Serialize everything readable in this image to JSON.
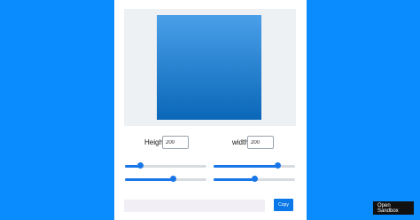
{
  "controls": {
    "height_label": "Height",
    "height_value": "200",
    "width_label": "width",
    "width_value": "200"
  },
  "sliders": [
    {
      "name": "slider-1",
      "value": 0.19
    },
    {
      "name": "slider-2",
      "value": 0.78
    },
    {
      "name": "slider-3",
      "value": 0.59
    },
    {
      "name": "slider-4",
      "value": 0.5
    }
  ],
  "output": {
    "css_text": "",
    "copy_label": "Copy"
  },
  "sandbox": {
    "line1": "Open",
    "line2": "Sandbox"
  },
  "colors": {
    "page_background": "#0a8cff",
    "accent": "#1976e8",
    "gradient_top": "#4a9fe8",
    "gradient_bottom": "#0a67b8"
  }
}
